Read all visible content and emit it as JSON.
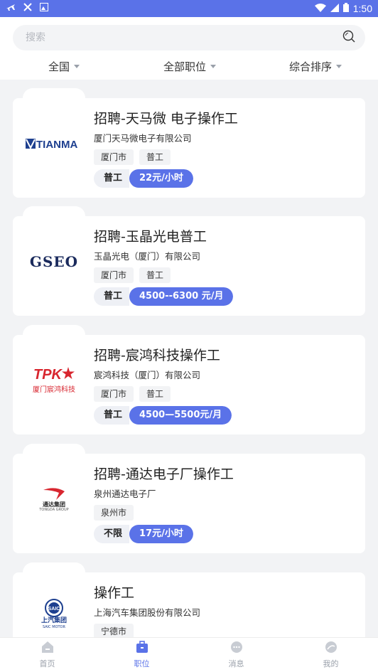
{
  "status_bar": {
    "time": "1:50"
  },
  "search": {
    "placeholder": "搜索"
  },
  "filters": [
    {
      "label": "全国"
    },
    {
      "label": "全部职位"
    },
    {
      "label": "综合排序"
    }
  ],
  "jobs": [
    {
      "title": "招聘-天马微 电子操作工",
      "company": "厦门天马微电子有限公司",
      "tags": [
        "厦门市",
        "普工"
      ],
      "type": "普工",
      "pay": "22元/小时",
      "logo": "TIANMA"
    },
    {
      "title": "招聘-玉晶光电普工",
      "company": "玉晶光电（厦门）有限公司",
      "tags": [
        "厦门市",
        "普工"
      ],
      "type": "普工",
      "pay": "4500--6300 元/月",
      "logo": "GSEO"
    },
    {
      "title": "招聘-宸鸿科技操作工",
      "company": "宸鸿科技（厦门）有限公司",
      "tags": [
        "厦门市",
        "普工"
      ],
      "type": "普工",
      "pay": "4500—5500元/月",
      "logo": "TPK",
      "logo_sub": "厦门宸鸿科技"
    },
    {
      "title": "招聘-通达电子厂操作工",
      "company": "泉州通达电子厂",
      "tags": [
        "泉州市"
      ],
      "type": "不限",
      "pay": "17元/小时",
      "logo": "通达集团",
      "logo_sub": "TONGDA GROUP"
    },
    {
      "title": "操作工",
      "company": "上海汽车集团股份有限公司",
      "tags": [
        "宁德市"
      ],
      "type": "",
      "pay": "",
      "logo": "SAIC",
      "logo_sub": "上汽集团",
      "logo_sub2": "SAIC MOTOR"
    }
  ],
  "tabs": [
    {
      "label": "首页",
      "icon": "home-icon"
    },
    {
      "label": "职位",
      "icon": "briefcase-icon"
    },
    {
      "label": "消息",
      "icon": "message-icon"
    },
    {
      "label": "我的",
      "icon": "profile-icon"
    }
  ],
  "colors": {
    "accent": "#5a72e8",
    "logo_blue": "#1d3f8f",
    "logo_red": "#d8262f"
  }
}
